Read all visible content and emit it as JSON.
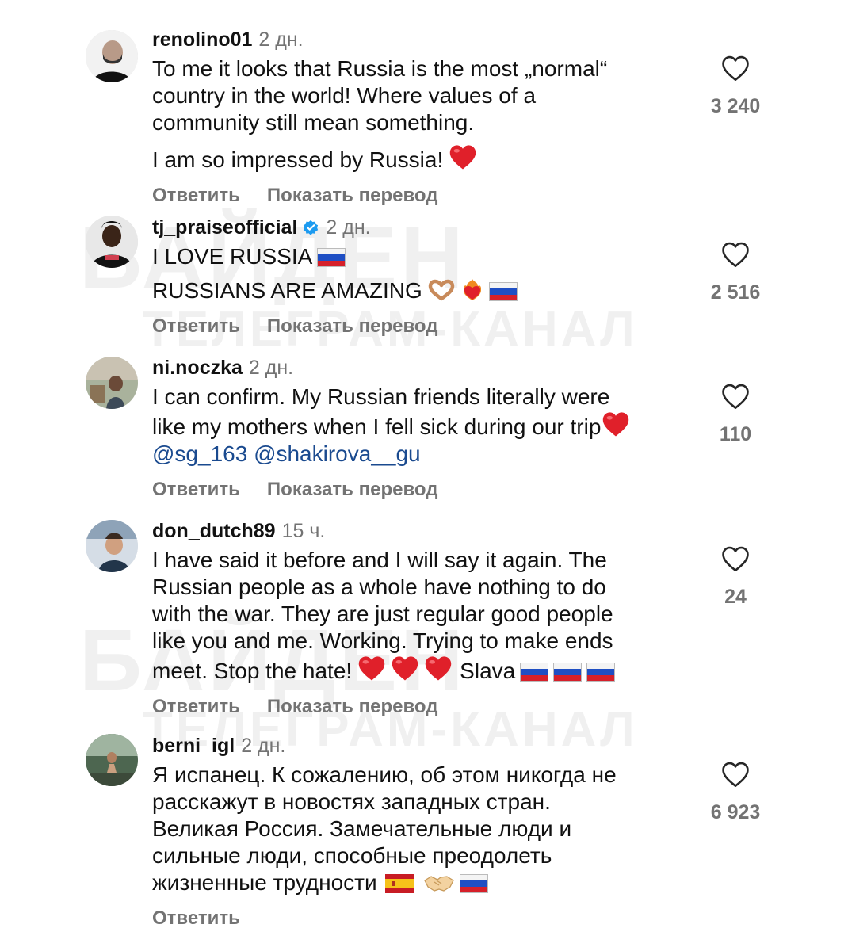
{
  "watermark": {
    "top_line": "БАЙДЕН",
    "bottom_line": "ТЕЛЕГРАМ-КАНАЛ"
  },
  "action_labels": {
    "reply": "Ответить",
    "translate": "Показать перевод"
  },
  "comments": [
    {
      "username": "renolino01",
      "time": "2 дн.",
      "lines": [
        "To me it looks that Russia is the most „normal“",
        "country in the world! Where values of a",
        "community still mean something.",
        "I am so impressed by Russia!"
      ],
      "likes": "3 240"
    },
    {
      "username": "tj_praiseofficial",
      "time": "2 дн.",
      "lines": [
        "I LOVE RUSSIA",
        "RUSSIANS ARE AMAZING"
      ],
      "likes": "2 516"
    },
    {
      "username": "ni.noczka",
      "time": "2 дн.",
      "lines": [
        "I can confirm. My Russian friends literally were",
        "like my mothers when I fell sick during our trip",
        "@sg_163 @shakirova__gu"
      ],
      "likes": "110"
    },
    {
      "username": "don_dutch89",
      "time": "15 ч.",
      "lines": [
        "I have said it before and I will say it again. The",
        "Russian people as a whole have nothing to do",
        "with the war. They are just regular good people",
        "like you and me. Working. Trying to make ends",
        "meet. Stop the hate!",
        "Slava"
      ],
      "likes": "24"
    },
    {
      "username": "berni_igl",
      "time": "2 дн.",
      "lines": [
        "Я испанец. К сожалению, об этом никогда не",
        "расскажут в новостях западных стран.",
        "Великая Россия. Замечательные люди и",
        "сильные люди, способные преодолеть",
        "жизненные трудности"
      ],
      "likes": "6 923"
    }
  ]
}
